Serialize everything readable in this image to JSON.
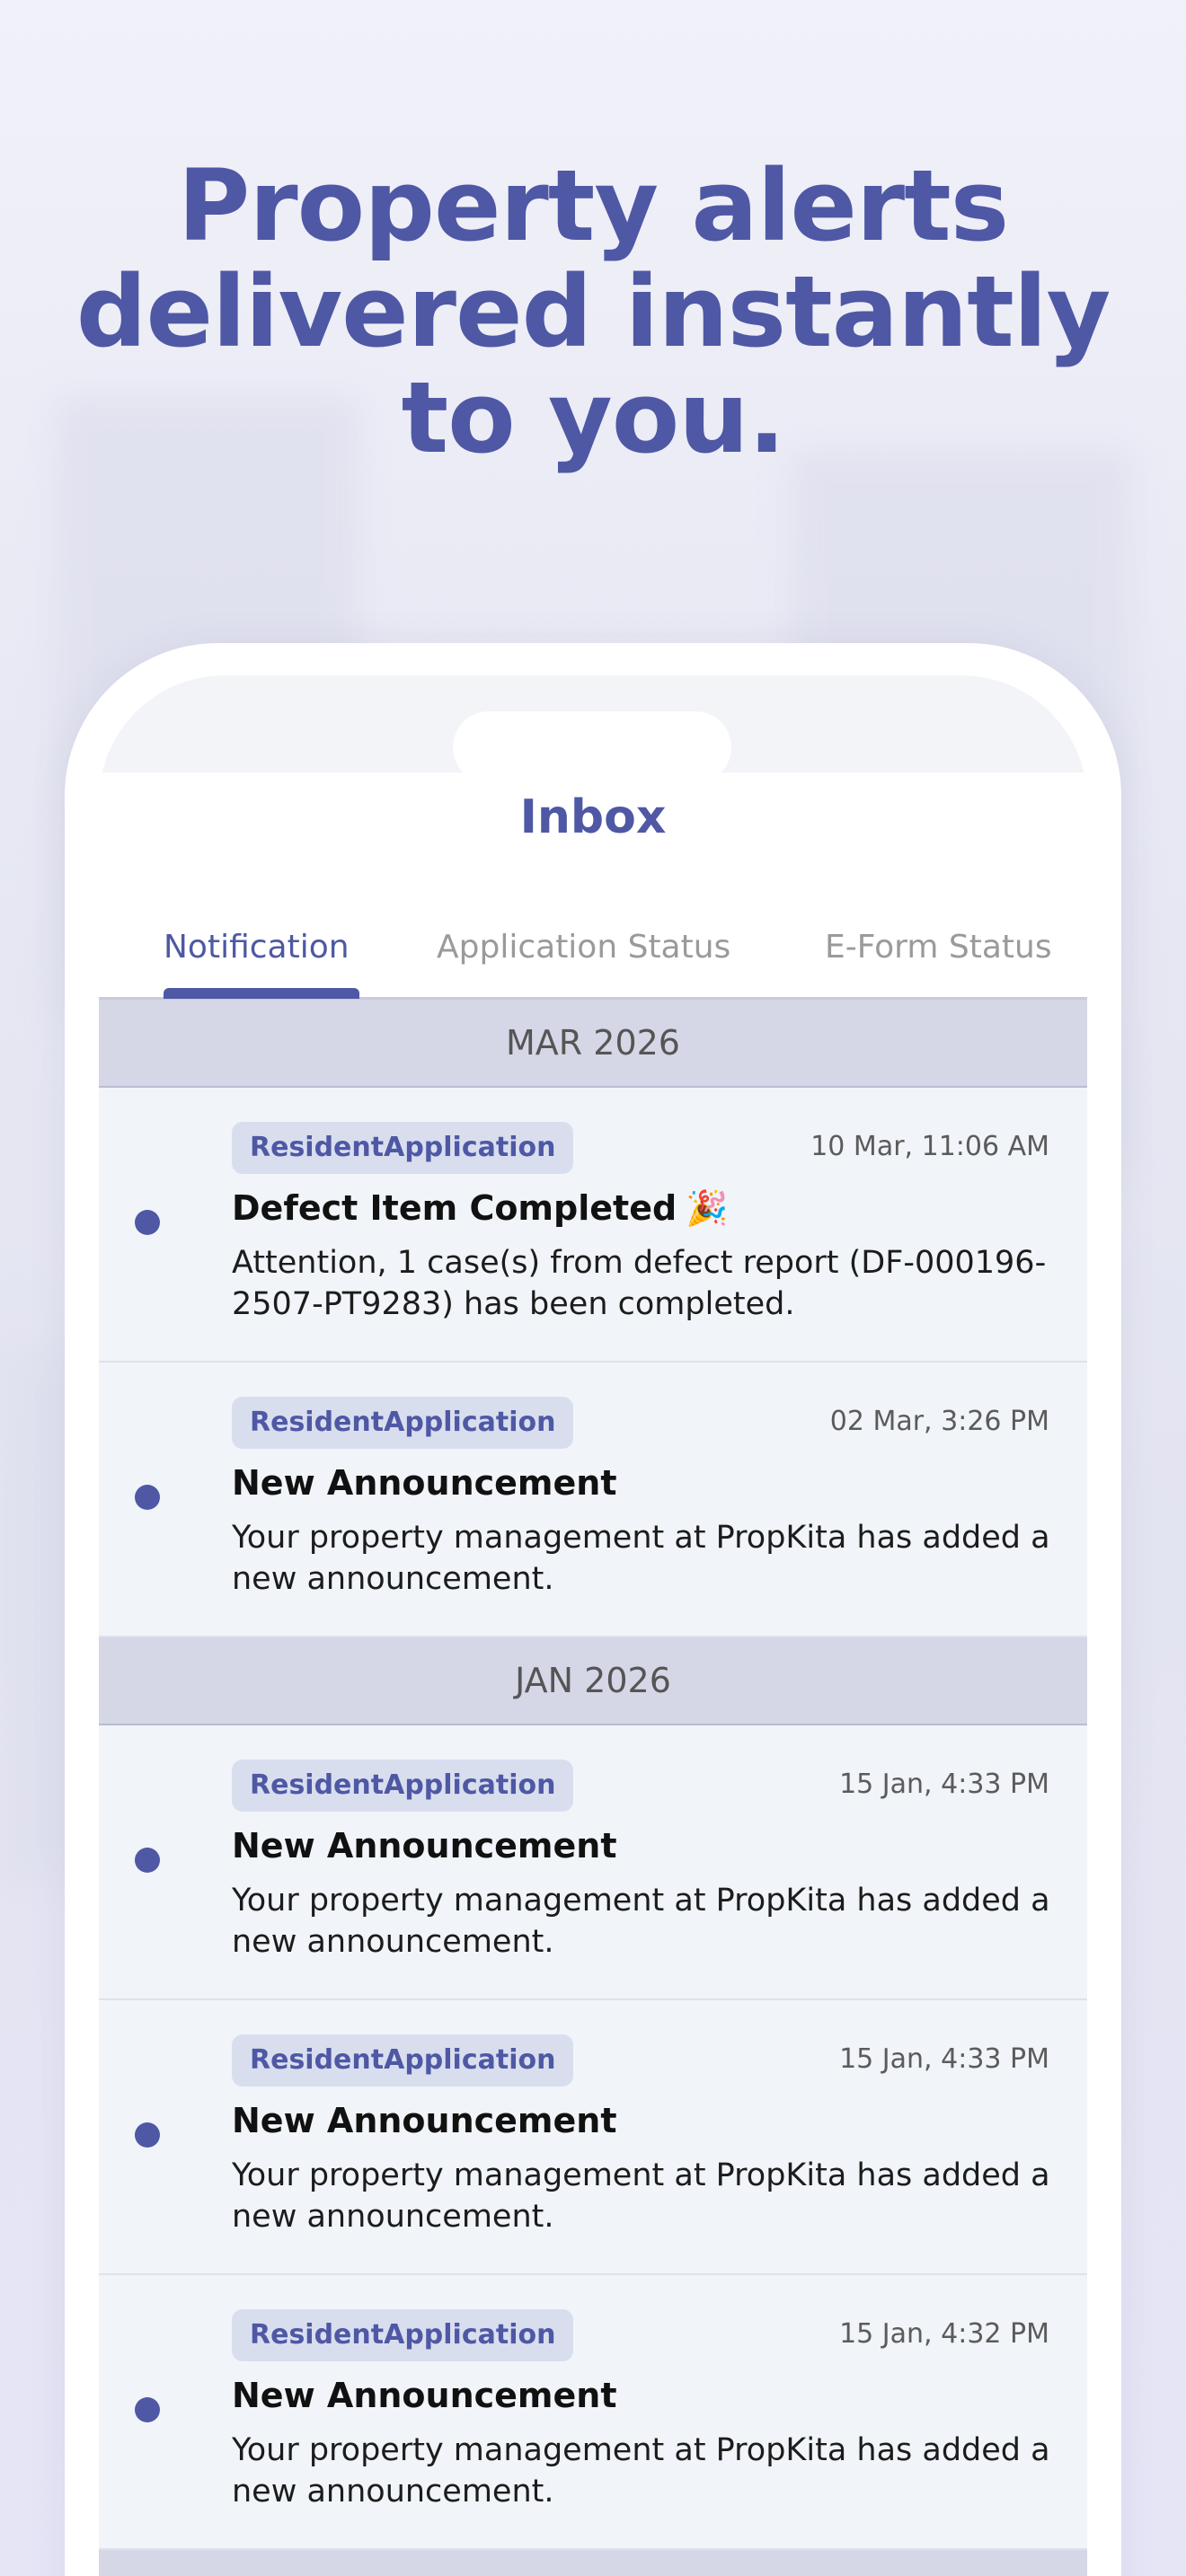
{
  "headline": {
    "line1": "Property alerts",
    "line2": "delivered instantly",
    "line3": "to you."
  },
  "app": {
    "title": "Inbox"
  },
  "tabs": [
    {
      "label": "Notification",
      "active": true
    },
    {
      "label": "Application Status",
      "active": false
    },
    {
      "label": "E-Form Status",
      "active": false
    }
  ],
  "groups": [
    {
      "month": "MAR 2026",
      "items": [
        {
          "tag": "ResidentApplication",
          "time": "10 Mar, 11:06 AM",
          "title": "Defect Item Completed",
          "title_icon": "party-popper-icon",
          "body": "Attention, 1 case(s) from defect report (DF-000196-2507-PT9283) has been completed.",
          "unread": true
        },
        {
          "tag": "ResidentApplication",
          "time": "02 Mar, 3:26 PM",
          "title": "New Announcement",
          "body": "Your property management at PropKita has added a new announcement.",
          "unread": true
        }
      ]
    },
    {
      "month": "JAN 2026",
      "items": [
        {
          "tag": "ResidentApplication",
          "time": "15 Jan, 4:33 PM",
          "title": "New Announcement",
          "body": "Your property management at PropKita has added a new announcement.",
          "unread": true
        },
        {
          "tag": "ResidentApplication",
          "time": "15 Jan, 4:33 PM",
          "title": "New Announcement",
          "body": "Your property management at PropKita has added a new announcement.",
          "unread": true
        },
        {
          "tag": "ResidentApplication",
          "time": "15 Jan, 4:32 PM",
          "title": "New Announcement",
          "body": "Your property management at PropKita has added a new announcement.",
          "unread": true
        }
      ]
    }
  ],
  "colors": {
    "accent": "#4e58a4",
    "tag_bg": "#d9deef",
    "month_bg": "#d5d7e7",
    "row_bg": "#f1f4f9"
  }
}
